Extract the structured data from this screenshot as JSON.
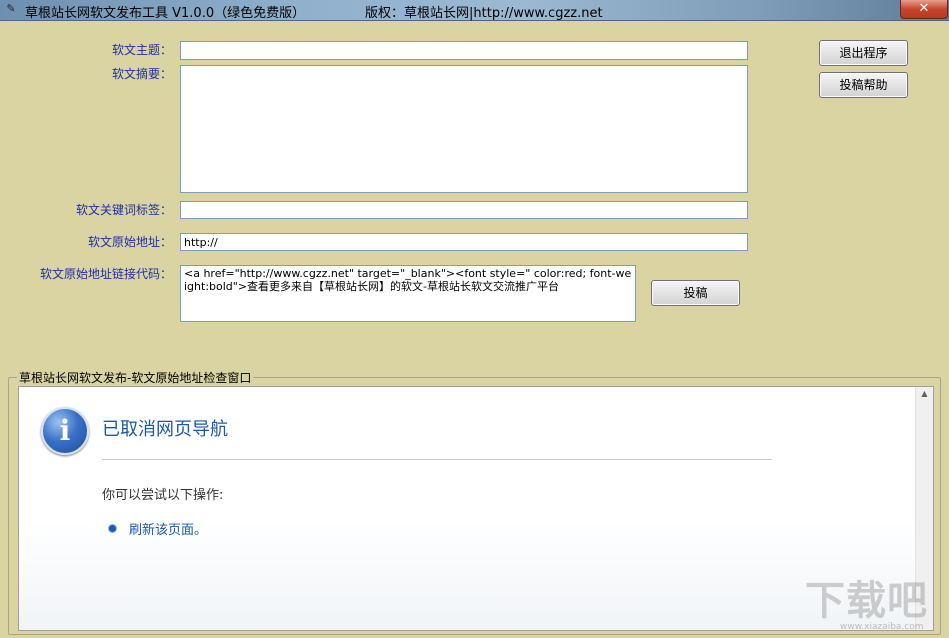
{
  "window": {
    "title": "草根站长网软文发布工具 V1.0.0（绿色免费版）",
    "copyright": "版权：草根站长网|http://www.cgzz.net",
    "close_label": "✕"
  },
  "form": {
    "subject_label": "软文主题：",
    "subject_value": "",
    "summary_label": "软文摘要：",
    "summary_value": "",
    "keywords_label": "软文关键词标签：",
    "keywords_value": "",
    "original_url_label": "软文原始地址：",
    "original_url_value": "http://",
    "link_code_label": "软文原始地址链接代码：",
    "link_code_value": "<a href=\"http://www.cgzz.net\" target=\"_blank\"><font style=\" color:red; font-weight:bold\">查看更多来自【草根站长网】的软文-草根站长软文交流推广平台"
  },
  "buttons": {
    "exit_label": "退出程序",
    "help_label": "投稿帮助",
    "submit_label": "投稿"
  },
  "check_panel": {
    "title": "草根站长网软文发布-软文原始地址检查窗口",
    "browser": {
      "heading": "已取消网页导航",
      "subheading": "你可以尝试以下操作:",
      "action_link": "刷新该页面。"
    }
  },
  "watermark": {
    "text": "下载吧",
    "url": "www.xiazaiba.com"
  }
}
